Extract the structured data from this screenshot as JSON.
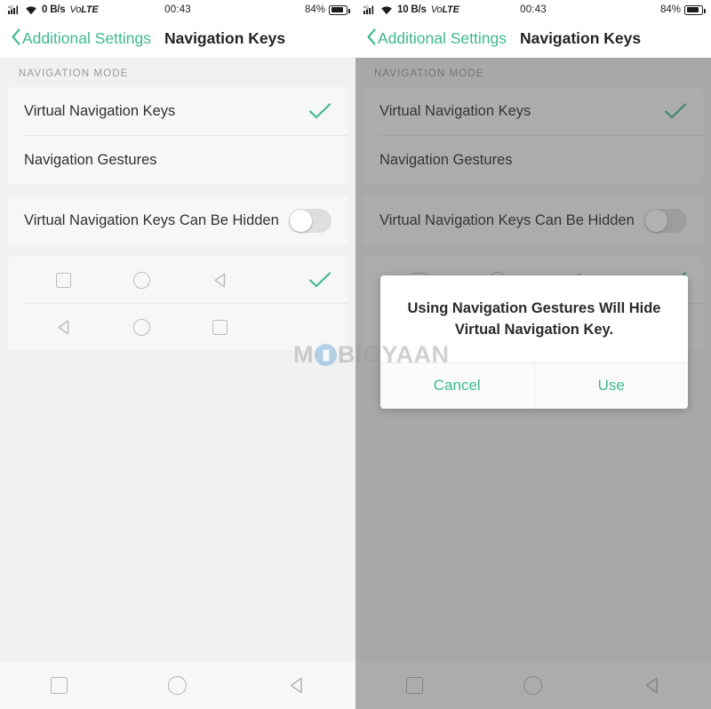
{
  "accent_color": "#3dba8f",
  "left_panel": {
    "status_bar": {
      "network_rate": "0 B/s",
      "volte_lead": "Vo",
      "volte_trail": "LTE",
      "clock": "00:43",
      "battery_percent": "84%",
      "signal_label": "4G",
      "signal_icon": "signal-bars-4g-icon",
      "wifi_icon": "wifi-icon",
      "battery_icon": "battery-icon"
    },
    "app_bar": {
      "back_label": "Additional Settings",
      "back_icon": "chevron-left-icon",
      "title": "Navigation Keys"
    },
    "section_label": "NAVIGATION MODE",
    "mode_rows": [
      {
        "label": "Virtual Navigation Keys",
        "selected": true
      },
      {
        "label": "Navigation Gestures",
        "selected": false
      }
    ],
    "hide_row": {
      "label": "Virtual Navigation Keys Can Be Hidden",
      "toggle_state": "off"
    },
    "key_layouts": [
      {
        "keys": [
          "recents-square-icon",
          "home-circle-icon",
          "back-triangle-icon"
        ],
        "selected": true
      },
      {
        "keys": [
          "back-triangle-icon",
          "home-circle-icon",
          "recents-square-icon"
        ],
        "selected": false
      }
    ],
    "nav_bar": [
      "recents-square-icon",
      "home-circle-icon",
      "back-triangle-icon"
    ]
  },
  "right_panel": {
    "status_bar": {
      "network_rate": "10 B/s",
      "volte_lead": "Vo",
      "volte_trail": "LTE",
      "clock": "00:43",
      "battery_percent": "84%",
      "signal_label": "4G",
      "signal_icon": "signal-bars-4g-icon",
      "wifi_icon": "wifi-icon",
      "battery_icon": "battery-icon"
    },
    "app_bar": {
      "back_label": "Additional Settings",
      "back_icon": "chevron-left-icon",
      "title": "Navigation Keys"
    },
    "section_label": "NAVIGATION MODE",
    "mode_rows": [
      {
        "label": "Virtual Navigation Keys",
        "selected": true
      },
      {
        "label": "Navigation Gestures",
        "selected": false
      }
    ],
    "hide_row": {
      "label": "Virtual Navigation Keys Can Be Hidden",
      "toggle_state": "off"
    },
    "dialog": {
      "message_line1": "Using Navigation Gestures Will Hide",
      "message_line2": "Virtual Navigation Key.",
      "cancel_label": "Cancel",
      "confirm_label": "Use"
    },
    "nav_bar": [
      "recents-square-icon",
      "home-circle-icon",
      "back-triangle-icon"
    ]
  },
  "watermark": {
    "prefix": "M",
    "suffix": "BIGYAAN"
  }
}
